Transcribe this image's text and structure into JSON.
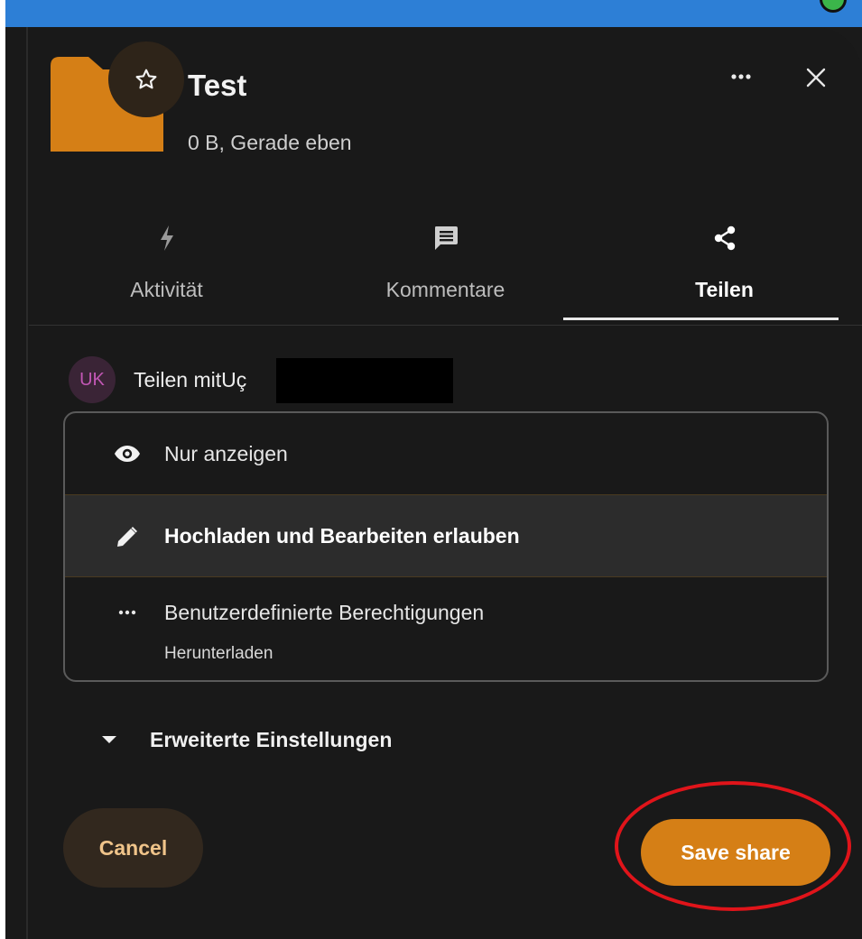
{
  "file": {
    "name": "Test",
    "meta": "0 B, Gerade eben",
    "icon": "folder-icon",
    "color": "#d57f16"
  },
  "header_actions": {
    "favorite_icon": "star-icon",
    "more_icon": "more-horizontal-icon",
    "close_icon": "close-icon"
  },
  "tabs": [
    {
      "label": "Aktivität",
      "icon": "lightning-icon",
      "active": false
    },
    {
      "label": "Kommentare",
      "icon": "comment-icon",
      "active": false
    },
    {
      "label": "Teilen",
      "icon": "share-icon",
      "active": true
    }
  ],
  "share_with": {
    "avatar_initials": "UK",
    "label": "Teilen mitUç"
  },
  "permissions": [
    {
      "label": "Nur anzeigen",
      "icon": "eye-icon",
      "selected": false
    },
    {
      "label": "Hochladen und Bearbeiten erlauben",
      "icon": "pencil-icon",
      "selected": true
    },
    {
      "label": "Benutzerdefinierte Berechtigungen",
      "sublabel": "Herunterladen",
      "icon": "more-horizontal-icon",
      "selected": false
    }
  ],
  "advanced": {
    "label": "Erweiterte Einstellungen",
    "icon": "caret-down-icon"
  },
  "footer": {
    "cancel_label": "Cancel",
    "save_label": "Save share"
  },
  "colors": {
    "accent": "#d57f16",
    "background": "#191919",
    "annotation": "#e0141a"
  }
}
